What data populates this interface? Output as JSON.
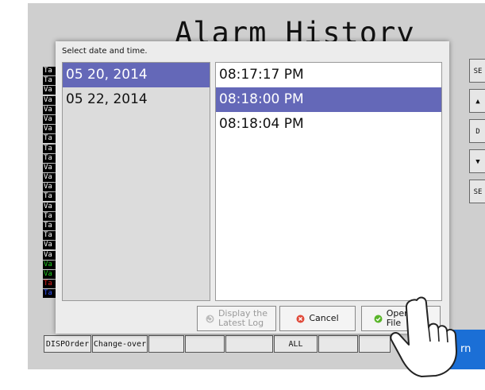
{
  "screen": {
    "title": "Alarm History",
    "row_tags": [
      {
        "text": "Ta",
        "bg": "#000000",
        "fg": "#ffffff"
      },
      {
        "text": "Ta",
        "bg": "#000000",
        "fg": "#ffffff"
      },
      {
        "text": "Va",
        "bg": "#000000",
        "fg": "#ffffff"
      },
      {
        "text": "Va",
        "bg": "#000000",
        "fg": "#ffffff"
      },
      {
        "text": "Va",
        "bg": "#000000",
        "fg": "#ffffff"
      },
      {
        "text": "Va",
        "bg": "#000000",
        "fg": "#ffffff"
      },
      {
        "text": "Va",
        "bg": "#000000",
        "fg": "#ffffff"
      },
      {
        "text": "Ta",
        "bg": "#000000",
        "fg": "#ffffff"
      },
      {
        "text": "Ta",
        "bg": "#000000",
        "fg": "#ffffff"
      },
      {
        "text": "Ta",
        "bg": "#000000",
        "fg": "#ffffff"
      },
      {
        "text": "Va",
        "bg": "#000000",
        "fg": "#ffffff"
      },
      {
        "text": "Va",
        "bg": "#000000",
        "fg": "#ffffff"
      },
      {
        "text": "Va",
        "bg": "#000000",
        "fg": "#ffffff"
      },
      {
        "text": "Ta",
        "bg": "#000000",
        "fg": "#ffffff"
      },
      {
        "text": "Va",
        "bg": "#000000",
        "fg": "#ffffff"
      },
      {
        "text": "Ta",
        "bg": "#000000",
        "fg": "#ffffff"
      },
      {
        "text": "Ta",
        "bg": "#000000",
        "fg": "#ffffff"
      },
      {
        "text": "Ta",
        "bg": "#000000",
        "fg": "#ffffff"
      },
      {
        "text": "Va",
        "bg": "#000000",
        "fg": "#ffffff"
      },
      {
        "text": "Va",
        "bg": "#000000",
        "fg": "#ffffff"
      },
      {
        "text": "Va",
        "bg": "#000000",
        "fg": "#22cc22"
      },
      {
        "text": "Va",
        "bg": "#000000",
        "fg": "#22cc22"
      },
      {
        "text": "Ta",
        "bg": "#000000",
        "fg": "#dd2222"
      },
      {
        "text": "Ta",
        "bg": "#000000",
        "fg": "#3355ff"
      }
    ],
    "bottom_buttons": [
      "DISPOrder",
      "Change-over",
      "",
      "",
      "",
      "ALL",
      "",
      ""
    ],
    "side_buttons": [
      "SE",
      "",
      "D",
      "",
      "SE"
    ],
    "blue_button_label": "rn"
  },
  "dialog": {
    "prompt": "Select date and time.",
    "dates": [
      {
        "label": "05 20, 2014",
        "selected": true
      },
      {
        "label": "05 22, 2014",
        "selected": false
      }
    ],
    "times": [
      {
        "label": "08:17:17 PM",
        "selected": false
      },
      {
        "label": "08:18:00 PM",
        "selected": true
      },
      {
        "label": "08:18:04 PM",
        "selected": false
      }
    ],
    "buttons": {
      "latest_line1": "Display the",
      "latest_line2": "Latest Log",
      "cancel": "Cancel",
      "open_line1": "Open Log",
      "open_line2": "File"
    }
  },
  "colors": {
    "selection": "#6468b8",
    "cancel_icon": "#e04a3a",
    "open_icon": "#5ab52a",
    "accent_button": "#1b6fd6"
  }
}
